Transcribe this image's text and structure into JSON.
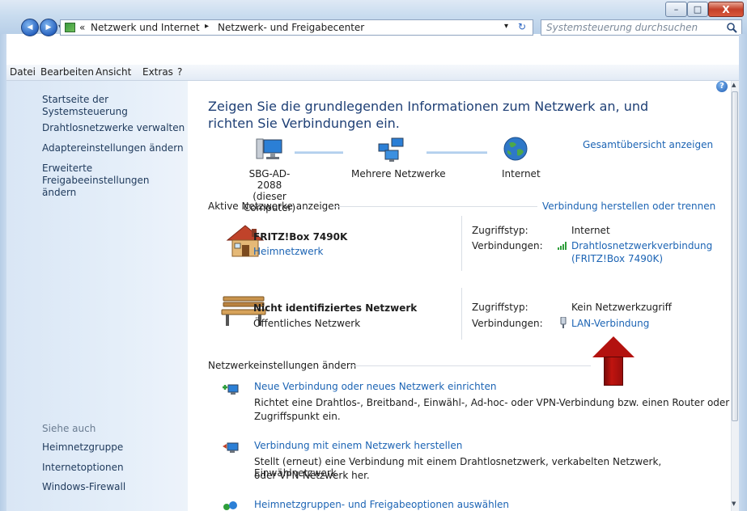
{
  "window": {
    "minimize_glyph": "–",
    "maximize_glyph": "□",
    "close_glyph": "X"
  },
  "address": {
    "back_glyph": "◀",
    "forward_glyph": "▶",
    "prefix": "«",
    "crumb1": "Netzwerk und Internet",
    "sep": "▸",
    "crumb2": "Netzwerk- und Freigabecenter",
    "dropdown": "▾",
    "refresh": "↻"
  },
  "search": {
    "placeholder": "Systemsteuerung durchsuchen",
    "icon": "search-icon"
  },
  "menu": {
    "file": "Datei",
    "edit": "Bearbeiten",
    "view": "Ansicht",
    "extras": "Extras",
    "help": "?"
  },
  "sidebar": {
    "home": "Startseite der Systemsteuerung",
    "items": [
      "Drahtlosnetzwerke verwalten",
      "Adaptereinstellungen ändern",
      "Erweiterte Freigabeeinstellungen ändern"
    ],
    "see_also": "Siehe auch",
    "see_also_items": [
      "Heimnetzgruppe",
      "Internetoptionen",
      "Windows-Firewall"
    ]
  },
  "main": {
    "heading": "Zeigen Sie die grundlegenden Informationen zum Netzwerk an, und richten Sie Verbindungen ein.",
    "overview_link": "Gesamtübersicht anzeigen",
    "map": {
      "computer": "SBG-AD-2088",
      "computer_sub": "(dieser Computer)",
      "networks": "Mehrere Netzwerke",
      "internet": "Internet"
    },
    "active_header": "Aktive Netzwerke anzeigen",
    "connect_link": "Verbindung herstellen oder trennen",
    "net1": {
      "name": "FRITZ!Box 7490K",
      "type": "Heimnetzwerk",
      "access_label": "Zugriffstyp:",
      "access": "Internet",
      "conn_label": "Verbindungen:",
      "conn": "Drahtlosnetzwerkverbindung",
      "conn2": "(FRITZ!Box 7490K)"
    },
    "net2": {
      "name": "Nicht identifiziertes Netzwerk",
      "type": "Öffentliches Netzwerk",
      "access_label": "Zugriffstyp:",
      "access": "Kein Netzwerkzugriff",
      "conn_label": "Verbindungen:",
      "conn": "LAN-Verbindung"
    },
    "settings_header": "Netzwerkeinstellungen ändern",
    "tasks": [
      {
        "title": "Neue Verbindung oder neues Netzwerk einrichten",
        "desc1": "Richtet eine Drahtlos-, Breitband-, Einwähl-, Ad-hoc- oder VPN-Verbindung bzw. einen Router oder",
        "desc2": "Zugriffspunkt ein."
      },
      {
        "title": "Verbindung mit einem Netzwerk herstellen",
        "desc1": "Stellt (erneut) eine Verbindung mit einem Drahtlosnetzwerk, verkabelten Netzwerk, Einwählnetzwerk",
        "desc2": "oder VPN-Netzwerk her."
      },
      {
        "title": "Heimnetzgruppen- und Freigabeoptionen auswählen"
      }
    ]
  },
  "colors": {
    "link": "#1c64b4",
    "sidebar_link": "#1e395b",
    "heading": "#1e3f75",
    "annotation_arrow": "#b3120f"
  }
}
